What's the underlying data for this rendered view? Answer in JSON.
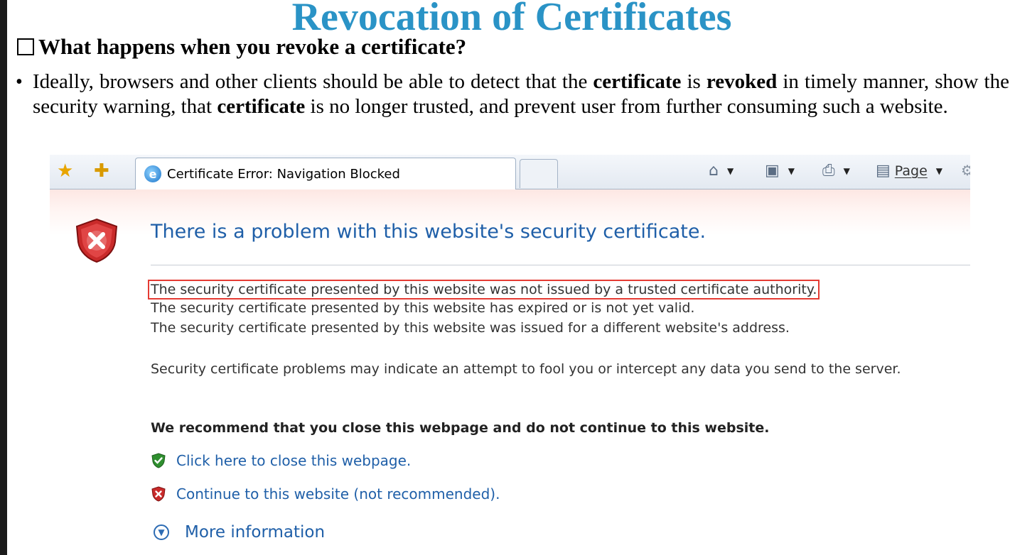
{
  "slide": {
    "title": "Revocation of Certificates",
    "subheading": "What happens when you revoke a certificate?",
    "bullet": {
      "part1": "Ideally, browsers and other clients should be able to detect that the ",
      "bold1": "certificate",
      "part2": " is ",
      "bold2": "revoked",
      "part3": " in timely manner, show the security warning, that ",
      "bold3": "certificate",
      "part4": " is no longer trusted, and prevent user from further consuming such a website."
    }
  },
  "browser": {
    "tab_title": "Certificate Error: Navigation Blocked",
    "page_menu_label": "Page",
    "page_menu_accesskey": "P",
    "page_menu_rest": "age",
    "icons": [
      "favorites-star-icon",
      "add-favorites-icon",
      "ie-logo-icon",
      "home-icon",
      "feeds-icon",
      "print-icon",
      "page-icon",
      "tools-gear-icon"
    ]
  },
  "error_page": {
    "heading": "There is a problem with this website's security certificate.",
    "reasons": [
      "The security certificate presented by this website was not issued by a trusted certificate authority.",
      "The security certificate presented by this website has expired or is not yet valid.",
      "The security certificate presented by this website was issued for a different website's address."
    ],
    "warning": "Security certificate problems may indicate an attempt to fool you or intercept any data you send to the server.",
    "recommendation": "We recommend that you close this webpage and do not continue to this website.",
    "close_link": "Click here to close this webpage.",
    "continue_link": "Continue to this website (not recommended).",
    "more_info_link": "More information",
    "highlight_color": "#e53b33",
    "link_color": "#1f5fa8"
  }
}
